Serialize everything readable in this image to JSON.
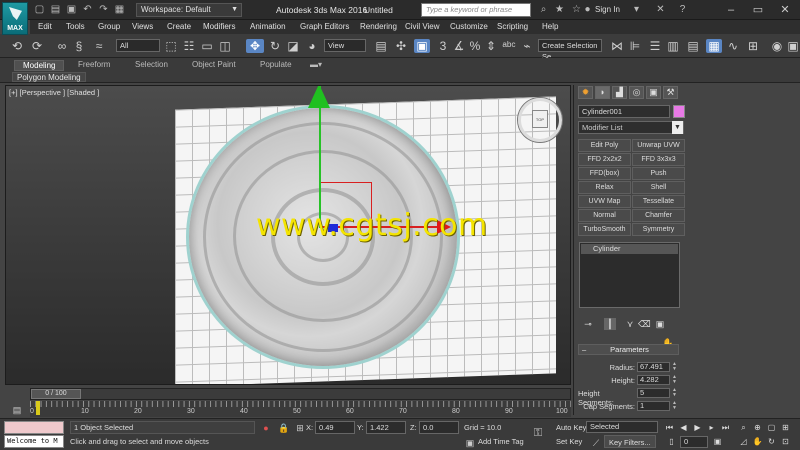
{
  "titlebar": {
    "app_title": "Autodesk 3ds Max 2016",
    "doc_title": "Untitled",
    "workspace": "Workspace: Default",
    "search_placeholder": "Type a keyword or phrase",
    "sign_in": "Sign In",
    "logo_text": "MAX"
  },
  "menu": [
    "Edit",
    "Tools",
    "Group",
    "Views",
    "Create",
    "Modifiers",
    "Animation",
    "Graph Editors",
    "Rendering",
    "Civil View",
    "Customize",
    "Scripting",
    "Help"
  ],
  "toolbar": {
    "filter": "All",
    "ref_coord": "View",
    "selection_set": "Create Selection Se"
  },
  "ribbon": {
    "tabs": [
      "Modeling",
      "Freeform",
      "Selection",
      "Object Paint",
      "Populate"
    ],
    "active_tab": "Modeling",
    "panel_label": "Polygon Modeling"
  },
  "viewport": {
    "label": "[+] [Perspective ] [Shaded ]",
    "watermark": "www.cgtsj.com",
    "viewcube_label": "TOP"
  },
  "command_panel": {
    "object_name": "Cylinder001",
    "object_color": "#e87ae6",
    "modifier_list": "Modifier List",
    "modifiers": [
      [
        "Edit Poly",
        "Unwrap UVW"
      ],
      [
        "FFD 2x2x2",
        "FFD 3x3x3"
      ],
      [
        "FFD(box)",
        "Push"
      ],
      [
        "Relax",
        "Shell"
      ],
      [
        "UVW Map",
        "Tessellate"
      ],
      [
        "Normal",
        "Chamfer"
      ],
      [
        "TurboSmooth",
        "Symmetry"
      ]
    ],
    "stack_item": "Cylinder",
    "rollout_title": "Parameters",
    "params": [
      {
        "label": "Radius:",
        "value": "67.491"
      },
      {
        "label": "Height:",
        "value": "4.282"
      },
      {
        "label": "Height Segments:",
        "value": "5"
      },
      {
        "label": "Cap Segments:",
        "value": "1"
      }
    ]
  },
  "timeline": {
    "slider": "0 / 100",
    "ticks": [
      "0",
      "10",
      "20",
      "30",
      "40",
      "50",
      "60",
      "70",
      "80",
      "90",
      "100"
    ]
  },
  "status": {
    "listener": "Welcome to M",
    "selection": "1 Object Selected",
    "prompt": "Click and drag to select and move objects",
    "x_label": "X:",
    "x": "0.49",
    "y_label": "Y:",
    "y": "1.422",
    "z_label": "Z:",
    "z": "0.0",
    "grid": "Grid = 10.0",
    "add_time_tag": "Add Time Tag",
    "auto_key": "Auto Key",
    "set_key": "Set Key",
    "key_mode": "Selected",
    "key_filters": "Key Filters...",
    "frame": "0"
  },
  "colors": {
    "gizmo_x": "#d82020",
    "gizmo_y": "#1f2ad8",
    "gizmo_z": "#20c020",
    "watermark": "#f4e400",
    "time_marker": "#d8c91a"
  }
}
